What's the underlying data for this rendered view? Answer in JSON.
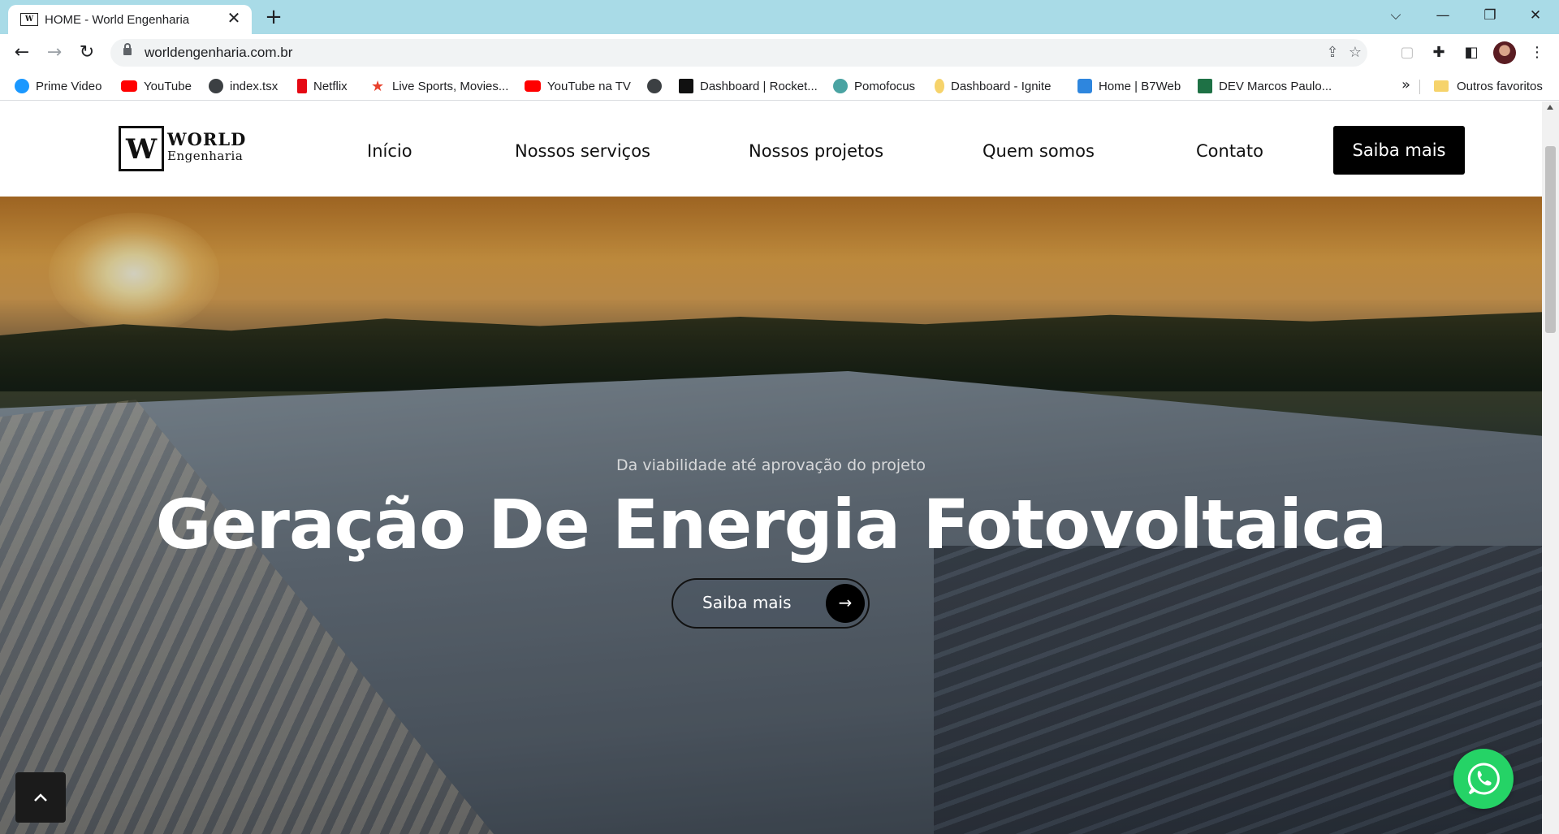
{
  "browser": {
    "tab": {
      "favicon_text": "W",
      "title": "HOME - World Engenharia",
      "close_symbol": "✕"
    },
    "new_tab_symbol": "+",
    "window_controls": {
      "list_tabs": "⌵",
      "minimize": "—",
      "restore": "❐",
      "close": "✕"
    },
    "nav": {
      "back": "←",
      "forward": "→",
      "reload": "↻"
    },
    "url": "worldengenharia.com.br",
    "bookmarks": [
      {
        "label": "Prime Video",
        "icon": "prime-video-icon",
        "color": "#1a98ff"
      },
      {
        "label": "YouTube",
        "icon": "youtube-icon",
        "color": "#ff0000"
      },
      {
        "label": "index.tsx",
        "icon": "globe-icon",
        "color": "#3c4043"
      },
      {
        "label": "Netflix",
        "icon": "netflix-icon",
        "color": "#e50914"
      },
      {
        "label": "Live Sports, Movies...",
        "icon": "star-icon",
        "color": "#e8412c"
      },
      {
        "label": "YouTube na TV",
        "icon": "youtube-icon",
        "color": "#ff0000"
      },
      {
        "label": "",
        "icon": "globe-icon",
        "color": "#3c4043"
      },
      {
        "label": "Dashboard | Rocket...",
        "icon": "rocketseat-icon",
        "color": "#111111"
      },
      {
        "label": "Pomofocus",
        "icon": "check-circle-icon",
        "color": "#4aa3a2"
      },
      {
        "label": "Dashboard - Ignite",
        "icon": "lightbulb-icon",
        "color": "#f6d36b"
      },
      {
        "label": "Home | B7Web",
        "icon": "b7web-icon",
        "color": "#2e86de"
      },
      {
        "label": "DEV Marcos Paulo...",
        "icon": "excel-icon",
        "color": "#1e7145"
      }
    ],
    "bookmarks_more": "»",
    "other_bookmarks": "Outros favoritos"
  },
  "site": {
    "logo": {
      "title": "WORLD",
      "subtitle": "Engenharia",
      "mark": "W"
    },
    "nav": [
      "Início",
      "Nossos serviços",
      "Nossos projetos",
      "Quem somos",
      "Contato"
    ],
    "header_cta": "Saiba mais",
    "hero": {
      "subtitle": "Da viabilidade até aprovação do projeto",
      "title": "Geração De Energia Fotovoltaica",
      "cta_label": "Saiba mais",
      "cta_icon": "arrow-right-icon"
    },
    "back_to_top_icon": "chevron-up-icon",
    "whatsapp_icon": "whatsapp-icon"
  },
  "colors": {
    "header_cta_bg": "#000000",
    "whatsapp": "#25d366",
    "tabbar": "#a9dbe7"
  }
}
